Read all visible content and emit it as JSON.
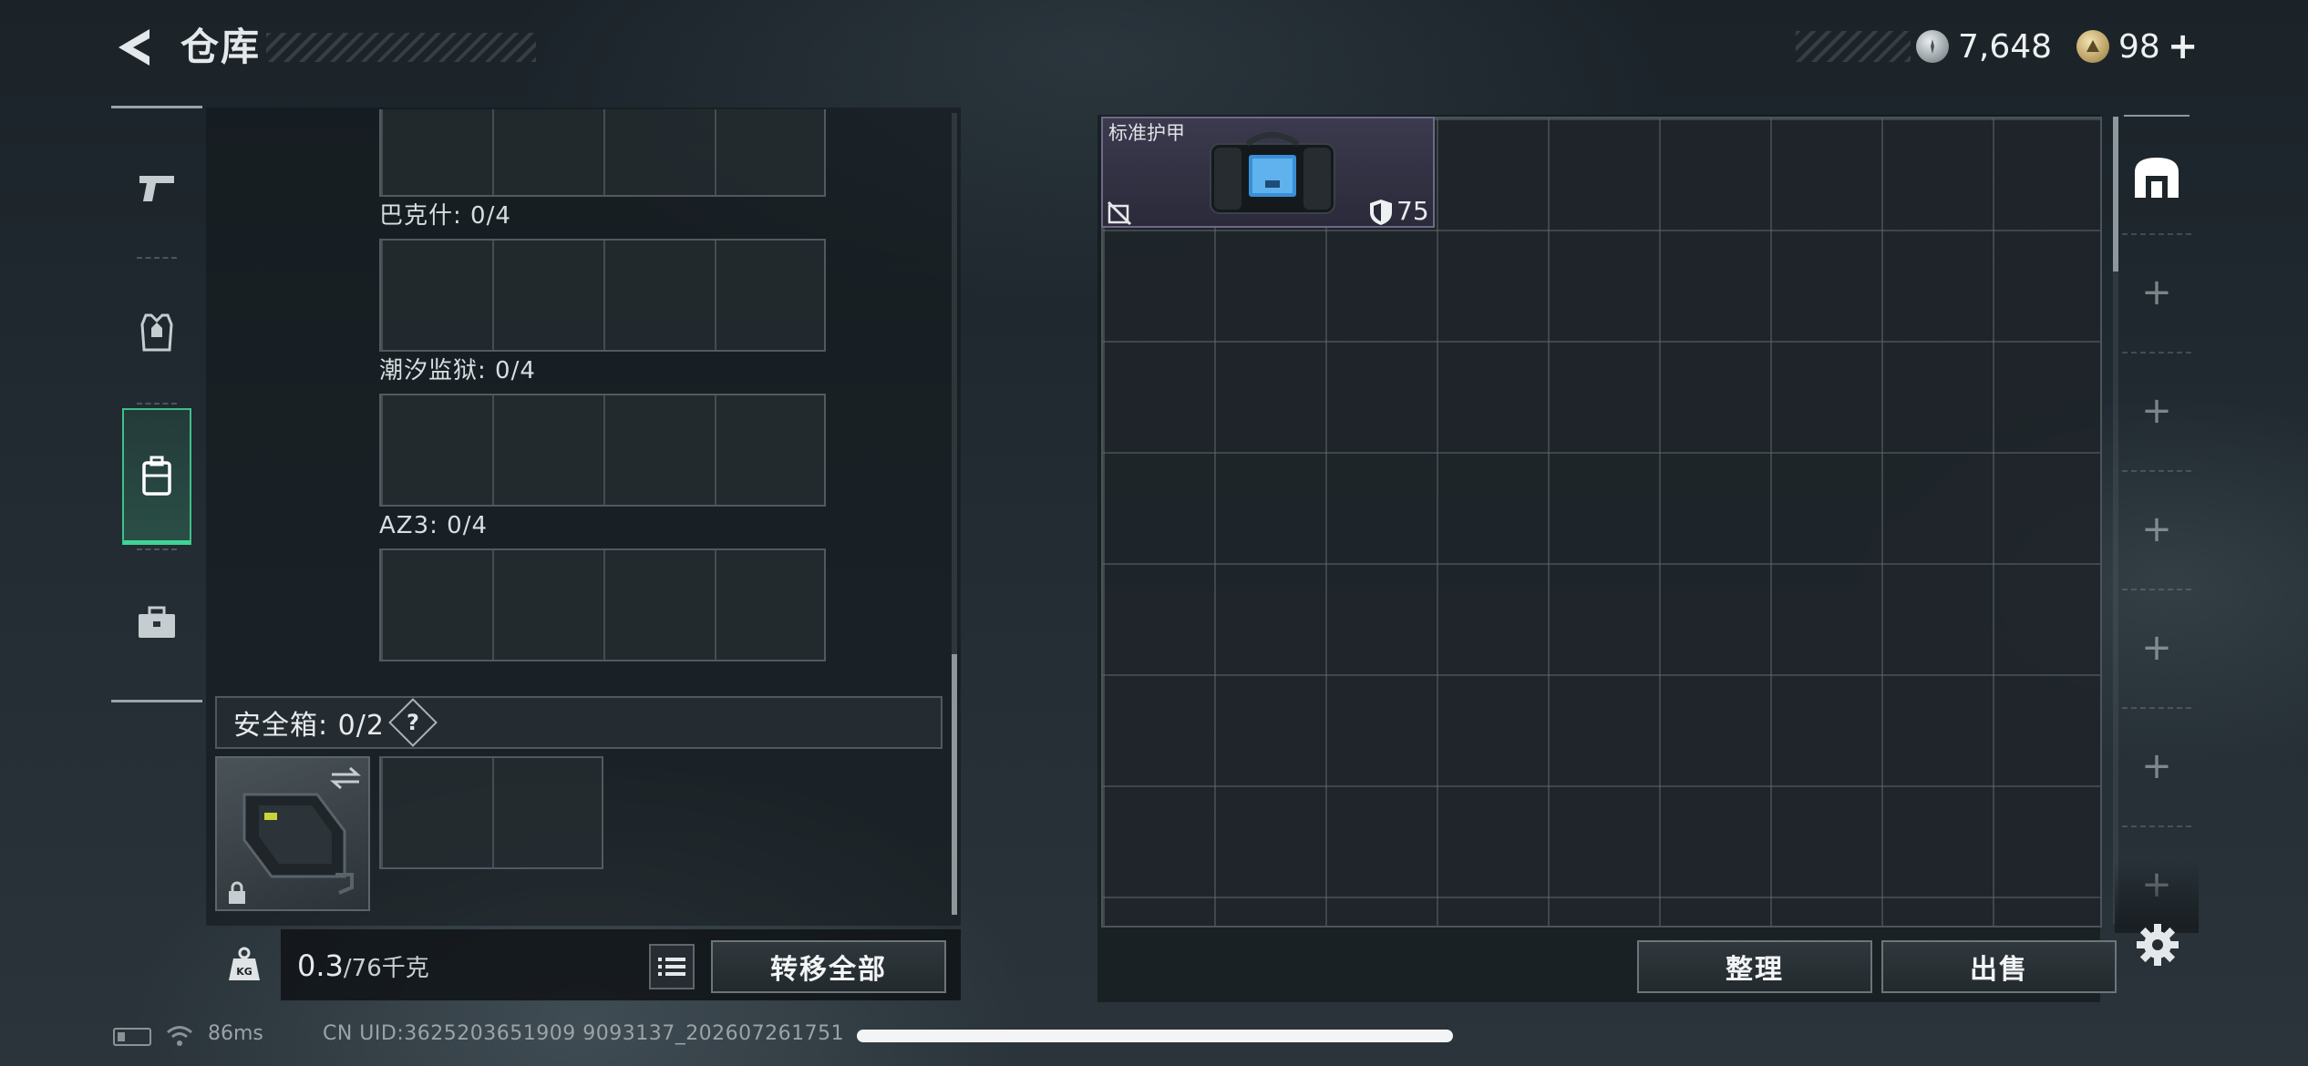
{
  "header": {
    "title": "仓库",
    "currency_silver": "7,648",
    "currency_gold": "98",
    "add_label": "+"
  },
  "nav": {
    "items": [
      "weapon",
      "armor",
      "backpack",
      "case"
    ],
    "active": "backpack"
  },
  "container": {
    "slots": [
      {
        "label": "巴克什: 0/4"
      },
      {
        "label": "潮汐监狱: 0/4"
      },
      {
        "label": "AZ3: 0/4"
      }
    ],
    "safebox_label": "安全箱: 0/2",
    "help_label": "?"
  },
  "weight": {
    "current": "0.3",
    "max": "/76千克",
    "icon_label": "KG"
  },
  "buttons": {
    "transfer_all": "转移全部",
    "sort": "整理",
    "sell": "出售"
  },
  "storage": {
    "item": {
      "name": "标准护甲",
      "durability": "75"
    },
    "add_tabs": [
      "+",
      "+",
      "+",
      "+",
      "+",
      "+"
    ]
  },
  "status": {
    "ping": "86ms",
    "uid": "CN UID:3625203651909 9093137_202607261751"
  },
  "colors": {
    "accent_green": "#3fd596",
    "item_rarity": "#6e6a86"
  }
}
